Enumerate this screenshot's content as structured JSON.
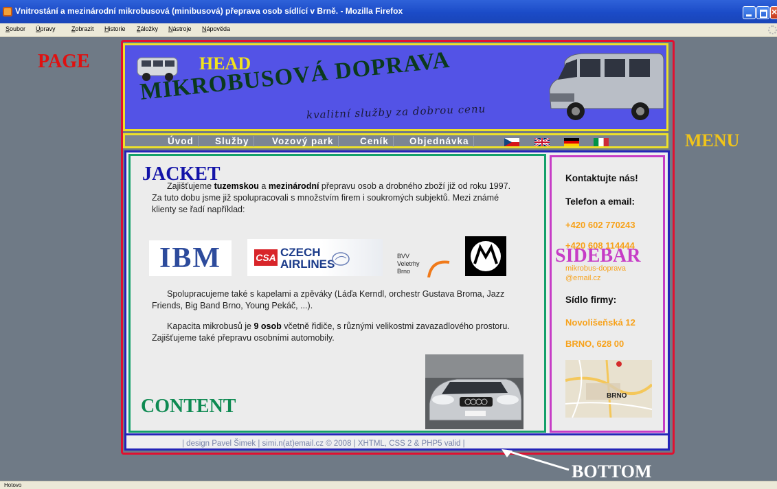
{
  "window": {
    "title": "Vnitrostání a mezinárodní mikrobusová (minibusová) přeprava osob sídlící v Brně. - Mozilla Firefox"
  },
  "menubar": [
    "Soubor",
    "Úpravy",
    "Zobrazit",
    "Historie",
    "Záložky",
    "Nástroje",
    "Nápověda"
  ],
  "status": "Hotovo",
  "site": {
    "title": "MIKROBUSOVÁ DOPRAVA",
    "slogan": "kvalitní služby za dobrou cenu",
    "nav": [
      "Úvod",
      "Služby",
      "Vozový park",
      "Ceník",
      "Objednávka"
    ],
    "flags": [
      "czech-flag",
      "uk-flag",
      "german-flag",
      "italian-flag"
    ],
    "content": {
      "p1_pre": "Zajišťujeme ",
      "p1_b1": "tuzemskou",
      "p1_mid": " a ",
      "p1_b2": "mezinárodní",
      "p1_post": " přepravu osob a drobného zboží již od roku 1997. Za tuto dobu jsme již spolupracovali s množstvím firem i soukromých subjektů. Mezi známé klienty se řadí například:",
      "p2": "Spolupracujeme také s kapelami a zpěváky (Láďa Kerndl, orchestr Gustava Broma, Jazz Friends, Big Band Brno, Young Pekáč, ...).",
      "p3_pre": "Kapacita mikrobusů je ",
      "p3_b": "9 osob",
      "p3_post": " včetně řidiče, s různými velikostmi zavazadlového prostoru. Zajišťujeme také přepravu osobními automobily.",
      "logos": {
        "ibm": "IBM",
        "csa_mark": "CSA",
        "csa_l1": "CZECH",
        "csa_l2": "AIRLINES",
        "bvv_l1": "BVV",
        "bvv_l2": "Veletrhy",
        "bvv_l3": "Brno"
      }
    },
    "sidebar": {
      "contact": "Kontaktujte nás!",
      "phone_heading": "Telefon a email:",
      "phone1": "+420 602 770243",
      "phone2": "+420 608 114444",
      "email_l1": "mikrobus-doprava",
      "email_l2": "@email.cz",
      "seat_heading": "Sídlo firmy:",
      "street": "Novolišeňská 12",
      "city": "BRNO, 628 00",
      "map_label": "BRNO"
    },
    "footer": "| design Pavel Šimek | simi.n(at)email.cz © 2008 | XHTML, CSS 2 & PHP5 valid |"
  },
  "annotations": {
    "page": "PAGE",
    "head": "HEAD",
    "menu": "MENU",
    "jacket": "JACKET",
    "content": "CONTENT",
    "sidebar": "SIDEBAR",
    "bottom": "BOTTOM"
  },
  "colors": {
    "page_border": "#e01030",
    "head_border": "#ede02a",
    "jacket_border": "#13a06a",
    "sidebar_border": "#c63cc6",
    "content_border": "#2424b8",
    "head_bg": "#5353e6",
    "accent_orange": "#f7a21b"
  }
}
